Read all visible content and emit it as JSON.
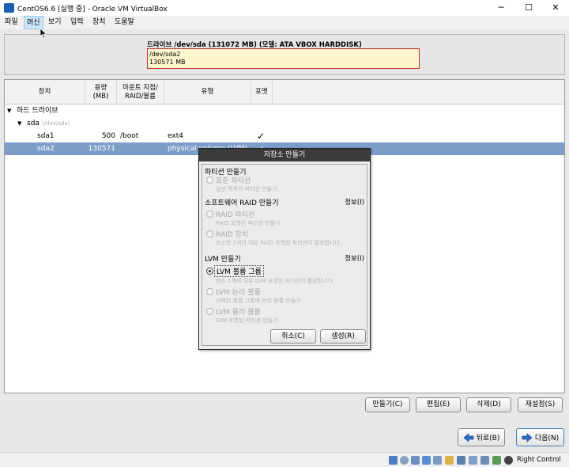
{
  "window": {
    "title": "CentOS6.6 [실행 중] - Oracle VM VirtualBox",
    "minimize": "─",
    "maximize": "☐",
    "close": "✕"
  },
  "menu": [
    "파일",
    "머신",
    "보기",
    "입력",
    "장치",
    "도움말"
  ],
  "drive": {
    "label": "드라이브 /dev/sda (131072 MB) (모델: ATA VBOX HARDDISK)",
    "partition_name": "/dev/sda2",
    "partition_size": "130571 MB"
  },
  "table": {
    "headers": {
      "device": "장치",
      "size": "용량\n(MB)",
      "mount": "마운트 지점/\nRAID/볼륨",
      "type": "유형",
      "format": "포맷"
    },
    "group": "하드 드라이브",
    "disk": {
      "name": "sda",
      "path": "(/dev/sda)"
    },
    "rows": [
      {
        "device": "sda1",
        "size": "500",
        "mount": "/boot",
        "type": "ext4",
        "format": "✓"
      },
      {
        "device": "sda2",
        "size": "130571",
        "mount": "",
        "type": "physical volume (LVM)",
        "format": "✓"
      }
    ]
  },
  "dialog": {
    "title": "저장소 만들기",
    "sections": {
      "partition": "파티션 만들기",
      "raid": "소프트웨어 RAID 만들기",
      "lvm": "LVM 만들기"
    },
    "info_label": "정보(I)",
    "options": {
      "standard": {
        "label": "표준 파티션",
        "desc": "일반 목적의 파티션 만들기"
      },
      "raid_partition": {
        "label": "RAID 파티션",
        "desc": "RAID 포맷된 파티션 만들기"
      },
      "raid_device": {
        "label": "RAID 장치",
        "desc": "최소한 2개의 여유 RAID 포맷된 파티션이 필요합니다."
      },
      "lvm_group": {
        "label": "LVM 볼륨 그룹",
        "desc": "최소 1개의 여유 LVM 포맷된 파티션이 필요합니다."
      },
      "lvm_logical": {
        "label": "LVM 논리 볼륨",
        "desc": "선택된 볼륨 그룹에 논리 볼륨 만들기"
      },
      "lvm_physical": {
        "label": "LVM 물리 볼륨",
        "desc": "LVM 포맷된 파티션 만들기"
      }
    },
    "cancel": "취소(C)",
    "create": "생성(R)"
  },
  "actions": {
    "create": "만들기(C)",
    "edit": "편집(E)",
    "delete": "삭제(D)",
    "reset": "재설정(S)"
  },
  "nav": {
    "back": "뒤로(B)",
    "next": "다음(N)"
  },
  "status": {
    "host_key": "Right Control"
  },
  "colors": {
    "selection": "#7c9ec9",
    "drive_box": "#fdf5cc",
    "drive_box_border": "#c83232",
    "dialog_title": "#3a3a3a"
  }
}
